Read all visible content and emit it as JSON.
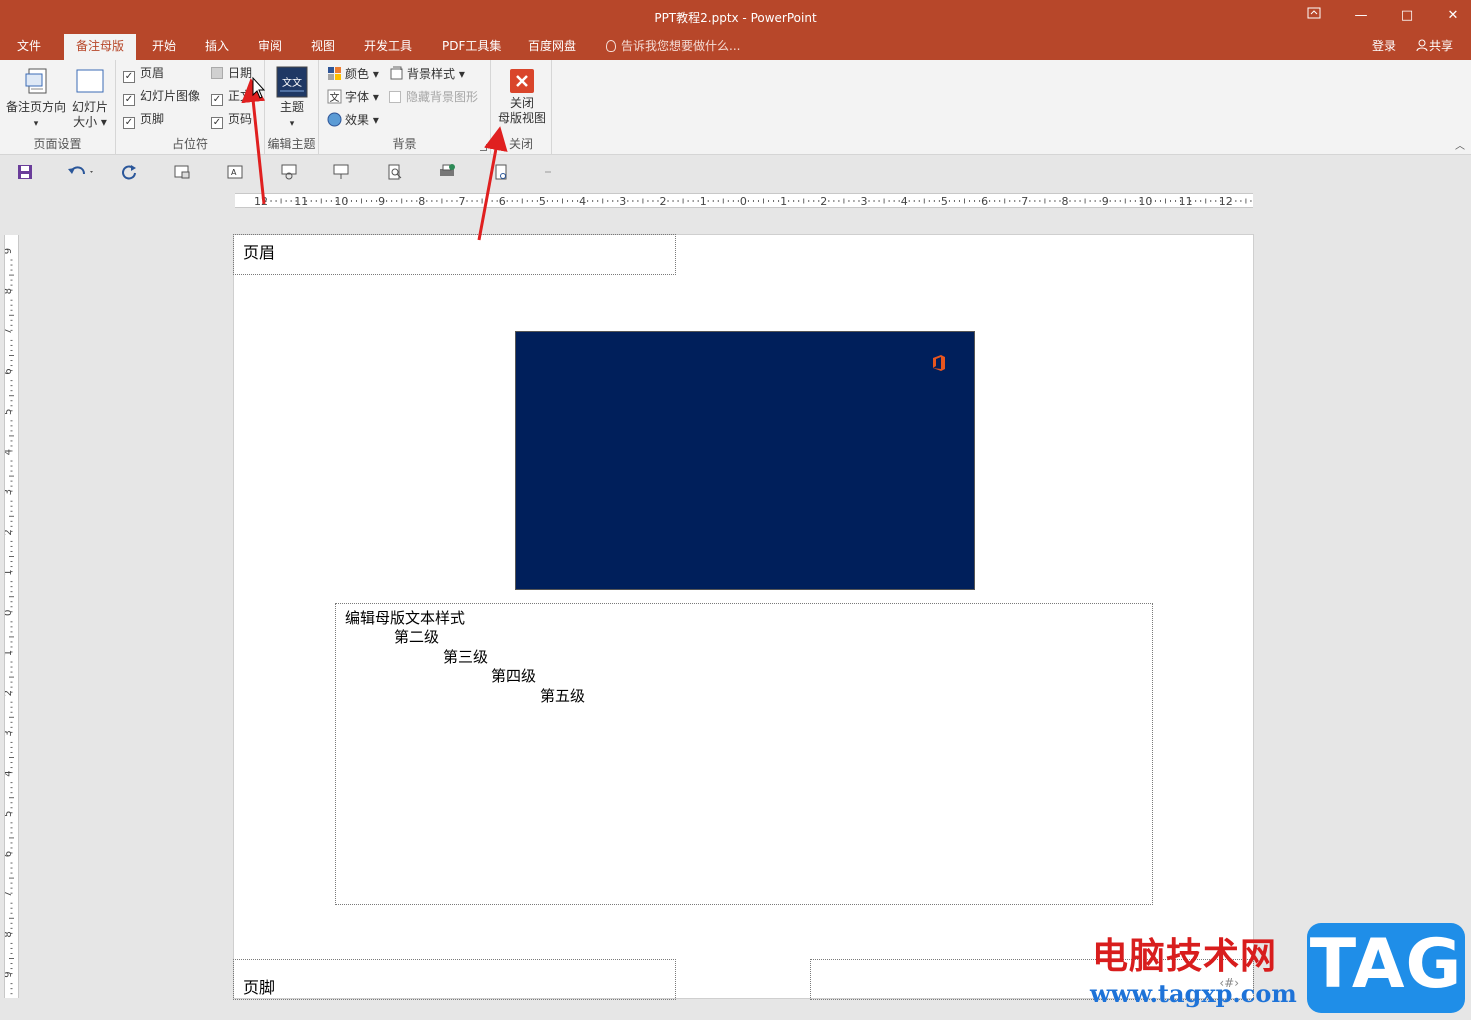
{
  "window": {
    "title": "PPT教程2.pptx - PowerPoint",
    "restore_icon": "ribbon-display-icon",
    "minimize": "—",
    "maximize": "□",
    "close": "✕"
  },
  "tabs": [
    {
      "label": "文件",
      "active": false
    },
    {
      "label": "备注母版",
      "active": true
    },
    {
      "label": "开始",
      "active": false
    },
    {
      "label": "插入",
      "active": false
    },
    {
      "label": "审阅",
      "active": false
    },
    {
      "label": "视图",
      "active": false
    },
    {
      "label": "开发工具",
      "active": false
    },
    {
      "label": "PDF工具集",
      "active": false
    },
    {
      "label": "百度网盘",
      "active": false
    }
  ],
  "tell_me": "告诉我您想要做什么...",
  "account": {
    "sign_in": "登录",
    "share": "共享"
  },
  "ribbon": {
    "page_setup": {
      "label": "页面设置",
      "orientation_line1": "备注页方向",
      "orientation_arrow": "▾",
      "slide_size_line1": "幻灯片",
      "slide_size_line2": "大小 ▾"
    },
    "placeholders": {
      "label": "占位符",
      "items": [
        {
          "label": "页眉",
          "checked": true
        },
        {
          "label": "幻灯片图像",
          "checked": true
        },
        {
          "label": "页脚",
          "checked": true
        },
        {
          "label": "日期",
          "checked": false
        },
        {
          "label": "正文",
          "checked": true
        },
        {
          "label": "页码",
          "checked": true
        }
      ]
    },
    "edit_theme": {
      "label": "编辑主题",
      "theme": "主题",
      "theme_arrow": "▾",
      "theme_icon_text": "文文"
    },
    "background": {
      "label": "背景",
      "colors": "颜色 ▾",
      "fonts": "字体 ▾",
      "effects": "效果 ▾",
      "bg_styles": "背景样式 ▾",
      "hide_bg": "隐藏背景图形"
    },
    "close": {
      "label": "关闭",
      "line1": "关闭",
      "line2": "母版视图"
    },
    "collapse": "︿"
  },
  "ruler": {
    "horizontal": [
      "12",
      "11",
      "10",
      "9",
      "8",
      "7",
      "6",
      "5",
      "4",
      "3",
      "2",
      "1",
      "0",
      "1",
      "2",
      "3",
      "4",
      "5",
      "6",
      "7",
      "8",
      "9",
      "10",
      "11",
      "12"
    ],
    "vertical": [
      "9",
      "8",
      "7",
      "6",
      "5",
      "4",
      "3",
      "2",
      "1",
      "0",
      "1",
      "2",
      "3",
      "4",
      "5",
      "6",
      "7",
      "8",
      "9"
    ]
  },
  "page": {
    "header": "页眉",
    "footer": "页脚",
    "page_number": "‹#›",
    "body_levels": [
      "编辑母版文本样式",
      "第二级",
      "第三级",
      "第四级",
      "第五级"
    ]
  },
  "colors": {
    "accent": "#b7472a",
    "slide_bg": "#001f5b",
    "arrow": "#e02020"
  },
  "watermark": {
    "cn": "电脑技术网",
    "url": "www.tagxp.com",
    "tag": "TAG"
  }
}
